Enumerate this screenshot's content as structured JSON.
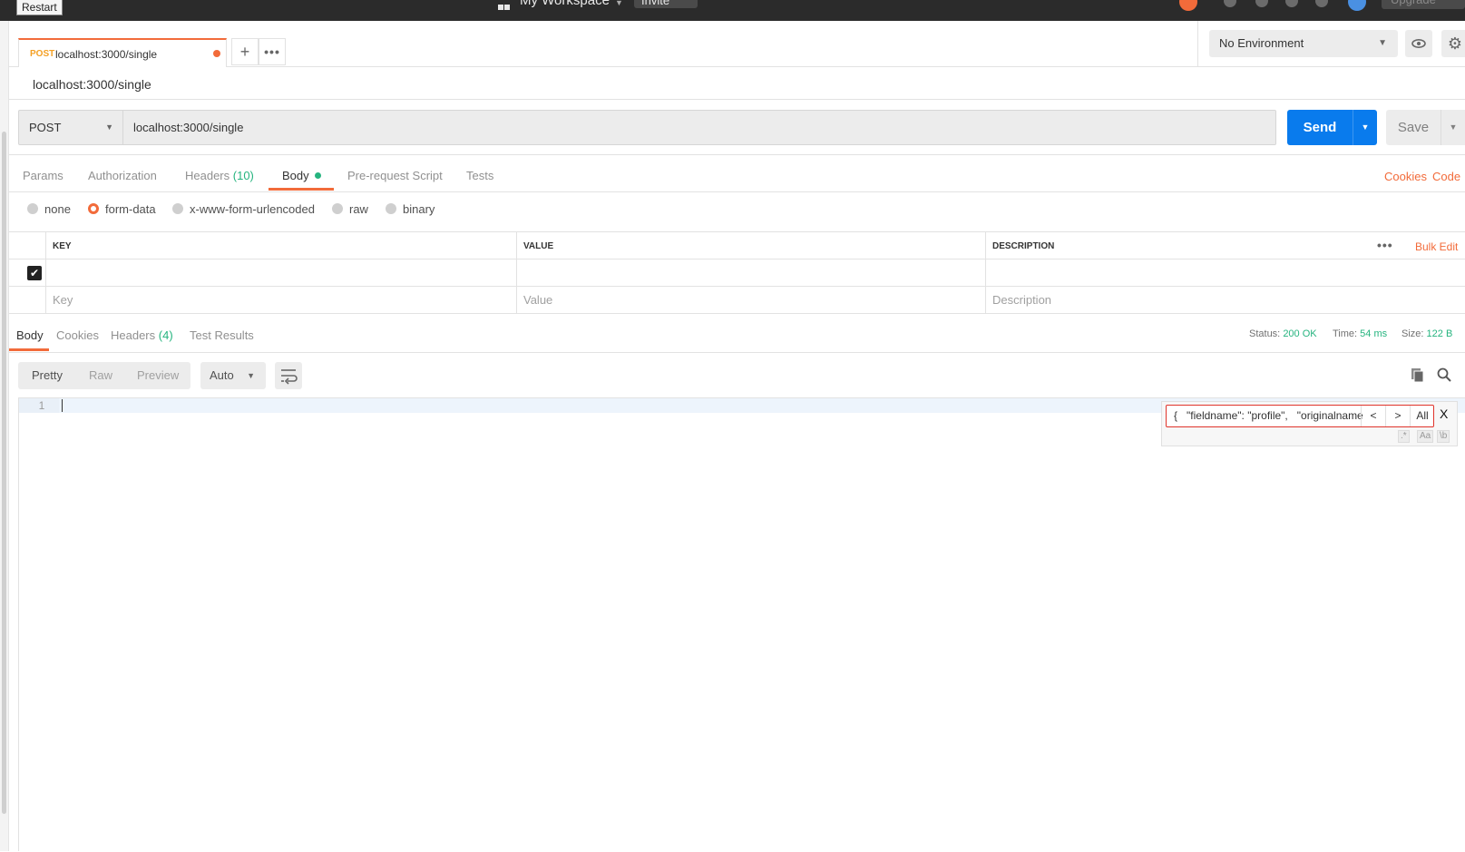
{
  "topbar": {
    "restart_label": "Restart",
    "workspace_name": "My Workspace",
    "invite_label": "Invite",
    "upgrade_label": "Upgrade",
    "colors": {
      "bg": "#2b2b2b",
      "accent_orange": "#f26b3a",
      "accent_blue": "#097bed"
    }
  },
  "tabs": [
    {
      "method": "POST",
      "url": "localhost:3000/single",
      "unsaved": true
    }
  ],
  "environment": {
    "selected": "No Environment"
  },
  "request": {
    "title": "localhost:3000/single",
    "method": "POST",
    "url": "localhost:3000/single",
    "send_label": "Send",
    "save_label": "Save"
  },
  "request_tabs": {
    "params": "Params",
    "authorization": "Authorization",
    "headers": "Headers",
    "headers_count": "(10)",
    "body": "Body",
    "prerequest": "Pre-request Script",
    "tests": "Tests",
    "cookies": "Cookies",
    "code": "Code"
  },
  "body_modes": {
    "none": "none",
    "form_data": "form-data",
    "urlencoded": "x-www-form-urlencoded",
    "raw": "raw",
    "binary": "binary",
    "selected": "form-data"
  },
  "form_table": {
    "headers": {
      "key": "KEY",
      "value": "VALUE",
      "description": "DESCRIPTION"
    },
    "bulk_edit": "Bulk Edit",
    "placeholders": {
      "key": "Key",
      "value": "Value",
      "description": "Description"
    }
  },
  "response": {
    "tabs": {
      "body": "Body",
      "cookies": "Cookies",
      "headers": "Headers",
      "headers_count": "(4)",
      "test_results": "Test Results"
    },
    "status_label": "Status:",
    "status_value": "200 OK",
    "time_label": "Time:",
    "time_value": "54 ms",
    "size_label": "Size:",
    "size_value": "122 B",
    "view_modes": {
      "pretty": "Pretty",
      "raw": "Raw",
      "preview": "Preview"
    },
    "format": "Auto",
    "line_number": "1"
  },
  "search": {
    "query": "{   \"fieldname\": \"profile\",   \"originalname",
    "prev": "<",
    "next": ">",
    "all": "All",
    "close": "X",
    "opt_regex": ".*",
    "opt_case": "Aa",
    "opt_word": "\\b"
  }
}
